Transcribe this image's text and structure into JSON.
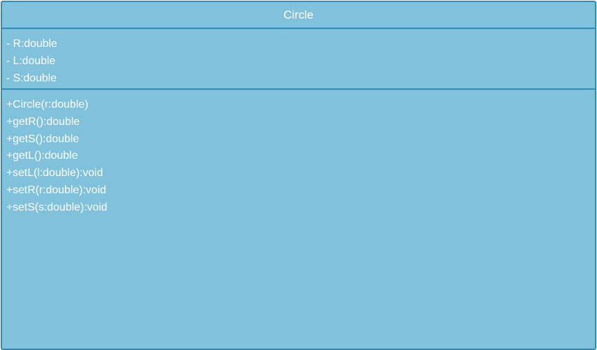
{
  "class": {
    "name": "Circle",
    "attributes": [
      "- R:double",
      "- L:double",
      "- S:double"
    ],
    "operations": [
      "+Circle(r:double)",
      "+getR():double",
      "+getS():double",
      "+getL():double",
      "+setL(l:double):void",
      "+setR(r:double):void",
      "+setS(s:double):void"
    ]
  },
  "colors": {
    "fill": "#80c2dc",
    "border": "#2e8bb5",
    "text": "#ffffff"
  }
}
